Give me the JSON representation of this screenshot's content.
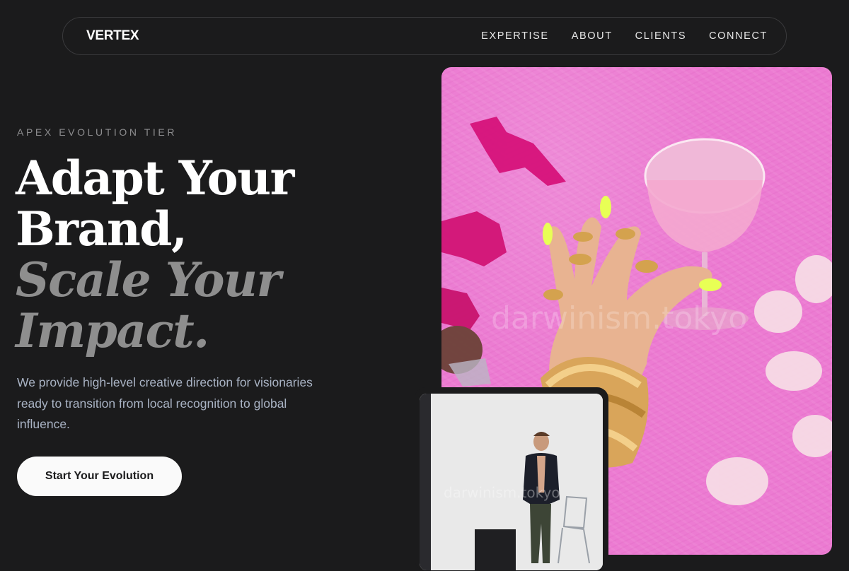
{
  "nav": {
    "logo": "VERTEX",
    "links": [
      "EXPERTISE",
      "ABOUT",
      "CLIENTS",
      "CONNECT"
    ]
  },
  "hero": {
    "eyebrow": "APEX EVOLUTION TIER",
    "headline": [
      "Adapt Your",
      "Brand,",
      "Scale Your",
      "Impact."
    ],
    "description": "We provide high-level creative direction for visionaries ready to transition from local recognition to global influence.",
    "cta_label": "Start Your Evolution"
  },
  "images": {
    "main_watermark": "darwinism.tokyo",
    "small_watermark": "darwinism.tokyo"
  },
  "colors": {
    "background": "#1b1b1c",
    "headline_primary": "#ffffff",
    "headline_muted": "#8e8e8e",
    "body_text": "#a9b3c4",
    "cta_bg": "#fafafa",
    "photo_pink": "#ec7bd2"
  }
}
